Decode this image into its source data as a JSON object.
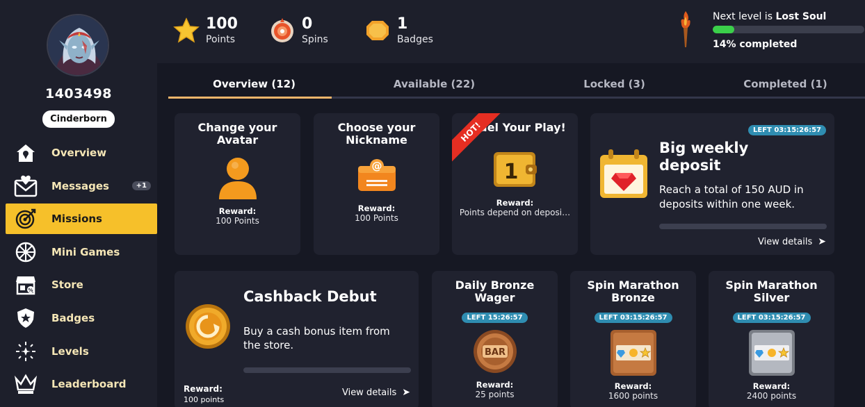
{
  "profile": {
    "username": "1403498",
    "tier": "Cinderborn"
  },
  "nav": [
    {
      "label": "Overview",
      "icon": "home-icon"
    },
    {
      "label": "Messages",
      "icon": "envelope-heart-icon",
      "badge": "+1"
    },
    {
      "label": "Missions",
      "icon": "target-icon"
    },
    {
      "label": "Mini Games",
      "icon": "wheel-icon"
    },
    {
      "label": "Store",
      "icon": "store-icon"
    },
    {
      "label": "Badges",
      "icon": "shield-star-icon"
    },
    {
      "label": "Levels",
      "icon": "sparkle-icon"
    },
    {
      "label": "Leaderboard",
      "icon": "crown-icon"
    }
  ],
  "stats": {
    "points": {
      "value": "100",
      "label": "Points"
    },
    "spins": {
      "value": "0",
      "label": "Spins"
    },
    "badges": {
      "value": "1",
      "label": "Badges"
    }
  },
  "level": {
    "prefix": "Next level is ",
    "name": "Lost Soul",
    "progress": 0.14,
    "completed_text": "14% completed"
  },
  "tabs": [
    "Overview (12)",
    "Available (22)",
    "Locked (3)",
    "Completed (1)"
  ],
  "cards": {
    "avatar": {
      "title": "Change your Avatar",
      "reward_label": "Reward:",
      "reward": "100 Points"
    },
    "nickname": {
      "title": "Choose your Nickname",
      "reward_label": "Reward:",
      "reward": "100 Points"
    },
    "fuel": {
      "title": "Fuel Your Play!",
      "ribbon": "HOT!",
      "reward_label": "Reward:",
      "reward": "Points depend on deposi…"
    },
    "weekly": {
      "timer": "LEFT 03:15:26:57",
      "title": "Big weekly deposit",
      "desc": "Reach a total of 150 AUD in deposits within one week.",
      "link": "View details"
    },
    "cashback": {
      "title": "Cashback Debut",
      "desc": "Buy a cash bonus item from the store.",
      "reward_label": "Reward:",
      "reward": "100 points",
      "link": "View details"
    },
    "bronze_wager": {
      "title": "Daily Bronze Wager",
      "timer": "LEFT 15:26:57",
      "reward_label": "Reward:",
      "reward": "25 points"
    },
    "spin_bronze": {
      "title": "Spin Marathon Bronze",
      "timer": "LEFT 03:15:26:57",
      "reward_label": "Reward:",
      "reward": "1600 points"
    },
    "spin_silver": {
      "title": "Spin Marathon Silver",
      "timer": "LEFT 03:15:26:57",
      "reward_label": "Reward:",
      "reward": "2400 points"
    }
  },
  "colors": {
    "accent": "#f6c02a",
    "background": "#161823",
    "panel": "#1d1f2b",
    "card": "#20222f",
    "timer": "#2f8db1",
    "progress": "#3bcf4a",
    "tab_underline": "#f2b56b"
  }
}
